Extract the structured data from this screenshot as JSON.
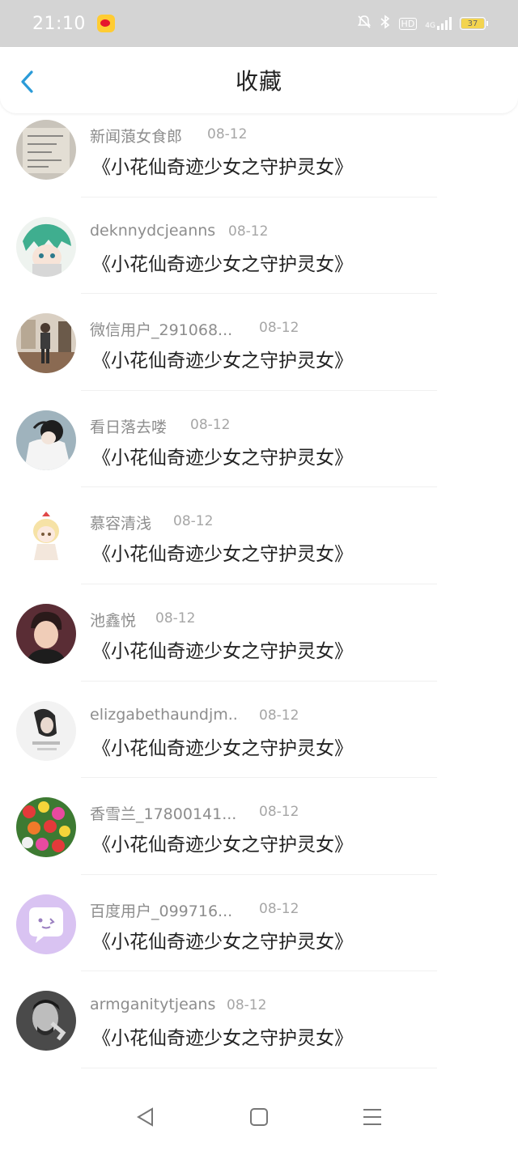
{
  "status_bar": {
    "time": "21:10",
    "icons": [
      "weibo-icon",
      "mute-bell-icon",
      "bluetooth-icon",
      "hd-icon",
      "4g-signal-icon",
      "battery-icon"
    ],
    "hd_label": "HD",
    "network_label": "4G",
    "battery_level": "37",
    "battery_color": "#f3d44f"
  },
  "header": {
    "back_icon": "chevron-left-icon",
    "title": "收藏",
    "accent": "#2b9bd8"
  },
  "items": [
    {
      "username": "新闻蒗女食郎",
      "date": "08-12",
      "title": "《小花仙奇迹少女之守护灵女》"
    },
    {
      "username": "deknnydcjeanns",
      "date": "08-12",
      "title": "《小花仙奇迹少女之守护灵女》"
    },
    {
      "username": "微信用户_291068...",
      "date": "08-12",
      "title": "《小花仙奇迹少女之守护灵女》"
    },
    {
      "username": "看日落去喽",
      "date": "08-12",
      "title": "《小花仙奇迹少女之守护灵女》"
    },
    {
      "username": "慕容清浅",
      "date": "08-12",
      "title": "《小花仙奇迹少女之守护灵女》"
    },
    {
      "username": "池鑫悦",
      "date": "08-12",
      "title": "《小花仙奇迹少女之守护灵女》"
    },
    {
      "username": "elizgabethaundjm...",
      "date": "08-12",
      "title": "《小花仙奇迹少女之守护灵女》"
    },
    {
      "username": "香雪兰_17800141...",
      "date": "08-12",
      "title": "《小花仙奇迹少女之守护灵女》"
    },
    {
      "username": "百度用户_099716...",
      "date": "08-12",
      "title": "《小花仙奇迹少女之守护灵女》"
    },
    {
      "username": "armganitytjeans",
      "date": "08-12",
      "title": "《小花仙奇迹少女之守护灵女》"
    }
  ],
  "nav_bar": {
    "buttons": [
      "back-triangle-icon",
      "home-square-icon",
      "menu-lines-icon"
    ]
  }
}
